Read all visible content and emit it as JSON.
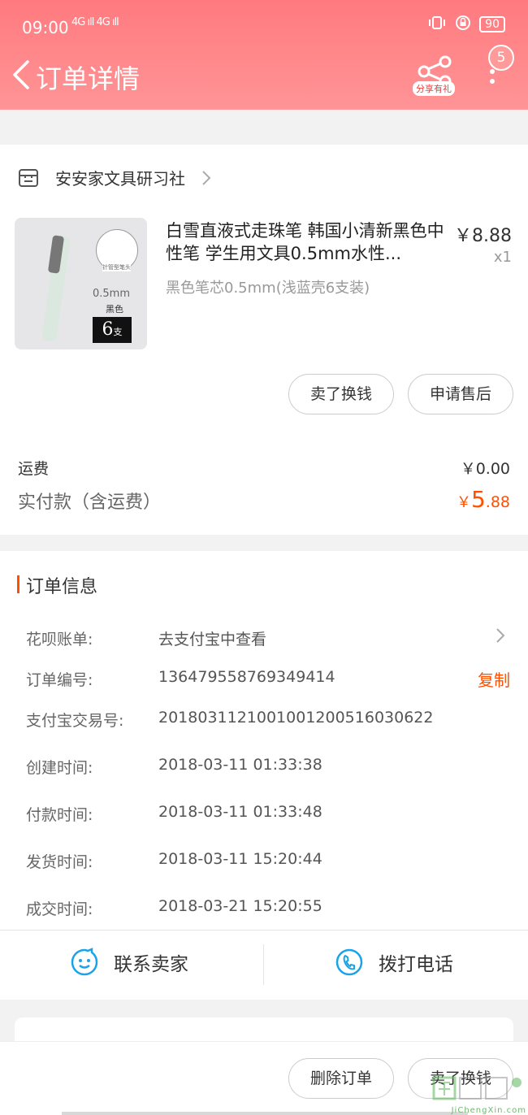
{
  "status_bar": {
    "time": "09:00",
    "signal": "4G ıll 4G ıll",
    "battery": "90"
  },
  "header": {
    "title": "订单详情",
    "share_label": "分享有礼",
    "badge_count": "5"
  },
  "store": {
    "name": "安安家文具研习社"
  },
  "product": {
    "title": "白雪直液式走珠笔 韩国小清新黑色中性笔 学生用文具0.5mm水性...",
    "spec": "黑色笔芯0.5mm(浅蓝壳6支装)",
    "price": "￥8.88",
    "quantity": "x1",
    "thumb_tag": "针管型笔头",
    "thumb_size": "0.5mm",
    "thumb_color": "黑色",
    "thumb_count": "6",
    "thumb_unit": "支"
  },
  "item_actions": {
    "sell_label": "卖了换钱",
    "after_sale_label": "申请售后"
  },
  "fees": {
    "shipping_label": "运费",
    "shipping_value": "￥0.00",
    "paid_label": "实付款（含运费）",
    "paid_currency": "￥",
    "paid_int": "5",
    "paid_dec": ".88"
  },
  "order_info": {
    "title": "订单信息",
    "copy_label": "复制",
    "rows": [
      {
        "k": "花呗账单:",
        "v": "去支付宝中查看"
      },
      {
        "k": "订单编号:",
        "v": "136479558769349414"
      },
      {
        "k": "支付宝交易号:",
        "v": "2018031121001001200516030622"
      },
      {
        "k": "创建时间:",
        "v": "2018-03-11 01:33:38"
      },
      {
        "k": "付款时间:",
        "v": "2018-03-11 01:33:48"
      },
      {
        "k": "发货时间:",
        "v": "2018-03-11 15:20:44"
      },
      {
        "k": "成交时间:",
        "v": "2018-03-21 15:20:55"
      }
    ]
  },
  "contact": {
    "seller_label": "联系卖家",
    "call_label": "拨打电话"
  },
  "bottom_bar": {
    "delete_label": "删除订单",
    "sell_label": "卖了换钱"
  },
  "watermark": "JiChengXin.com",
  "colors": {
    "header": "#ff8a8d",
    "accent": "#ff5000",
    "icon_blue": "#1aa3e8"
  }
}
